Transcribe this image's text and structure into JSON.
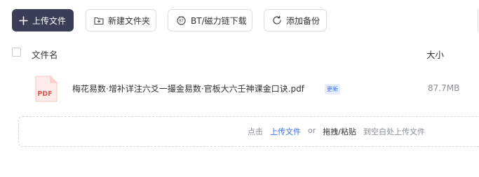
{
  "toolbar": {
    "upload_label": "上传文件",
    "new_folder_label": "新建文件夹",
    "bt_label": "BT/磁力链下载",
    "backup_label": "添加备份"
  },
  "table": {
    "header_name": "文件名",
    "header_size": "大小",
    "rows": [
      {
        "icon_text": "PDF",
        "name": "梅花易数·增补详注六爻一撮金易数·官板大六壬神课金口诀.pdf",
        "badge": "更新",
        "size": "87.7MB"
      }
    ]
  },
  "dropzone": {
    "prefix": "点击",
    "upload_link": "上传文件",
    "or": "or",
    "drag_paste": "拖拽/粘贴",
    "suffix": "到空白处上传文件"
  },
  "colors": {
    "primary_button": "#3b3e57",
    "link_blue": "#3d6fe0",
    "pdf_red": "#e05a4f"
  }
}
